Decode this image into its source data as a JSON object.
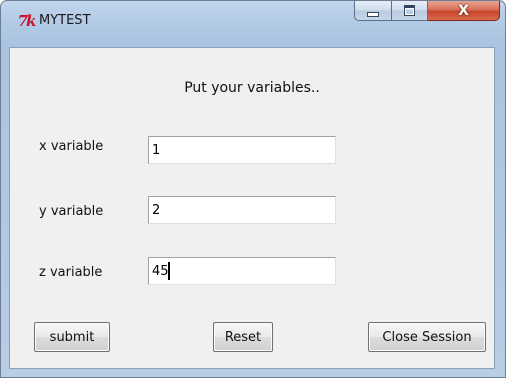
{
  "window": {
    "title": "MYTEST",
    "app_icon": "tk-feather-icon"
  },
  "caption": {
    "minimize_icon": "minimize-icon",
    "maximize_icon": "maximize-icon",
    "close_glyph": "X"
  },
  "form": {
    "heading": "Put your variables..",
    "fields": [
      {
        "label": "x variable",
        "value": "1"
      },
      {
        "label": "y variable",
        "value": "2"
      },
      {
        "label": "z variable",
        "value": "45"
      }
    ]
  },
  "buttons": {
    "submit": "submit",
    "reset": "Reset",
    "close_session": "Close Session"
  },
  "colors": {
    "tk_icon": "#c8102e",
    "close_button": "#c8452b",
    "frame": "#b3cbe6",
    "client": "#f0f0f0"
  }
}
